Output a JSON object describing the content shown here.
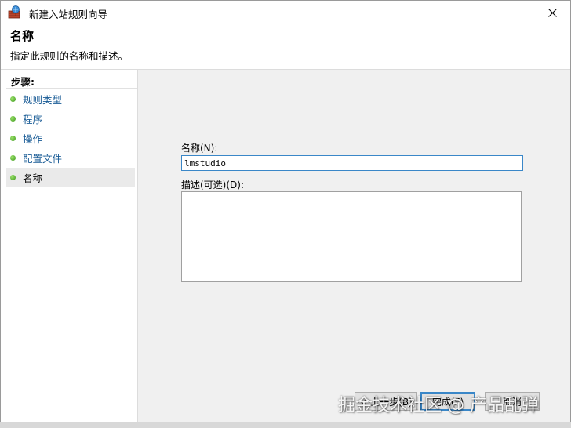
{
  "window": {
    "title": "新建入站规则向导",
    "close_glyph": "✕"
  },
  "header": {
    "title": "名称",
    "description": "指定此规则的名称和描述。"
  },
  "steps": {
    "heading": "步骤:",
    "items": [
      {
        "label": "规则类型"
      },
      {
        "label": "程序"
      },
      {
        "label": "操作"
      },
      {
        "label": "配置文件"
      },
      {
        "label": "名称"
      }
    ]
  },
  "form": {
    "name_label": "名称(N):",
    "name_value": "lmstudio",
    "desc_label": "描述(可选)(D):",
    "desc_value": ""
  },
  "buttons": {
    "back": "< 上一步(B)",
    "finish": "完成(F)",
    "cancel": "取消"
  },
  "watermark": "掘金技术社区 @ 产品乱弹"
}
